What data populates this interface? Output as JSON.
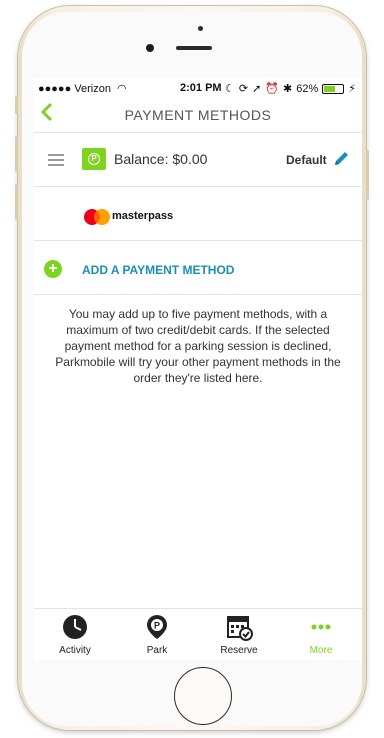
{
  "status_bar": {
    "carrier": "●●●●● Verizon",
    "time": "2:01 PM",
    "battery_percent": "62%",
    "battery_level": 0.62
  },
  "header": {
    "title": "PAYMENT METHODS"
  },
  "payment_methods": [
    {
      "type": "parkmobile-balance",
      "label": "Balance: $0.00",
      "default_label": "Default"
    },
    {
      "type": "masterpass",
      "label": "masterpass"
    }
  ],
  "add_method": {
    "label": "ADD A PAYMENT METHOD"
  },
  "info_text": "You may add up to five payment methods, with a maximum of two credit/debit cards. If the selected payment method for a parking session is declined, Parkmobile will try your other payment methods in the order they're listed here.",
  "tabs": [
    {
      "label": "Activity",
      "icon": "clock-icon",
      "active": false
    },
    {
      "label": "Park",
      "icon": "parking-pin-icon",
      "active": false
    },
    {
      "label": "Reserve",
      "icon": "calendar-check-icon",
      "active": false
    },
    {
      "label": "More",
      "icon": "more-dots-icon",
      "active": true
    }
  ],
  "colors": {
    "accent": "#7ed321",
    "link": "#1b8fb3"
  }
}
